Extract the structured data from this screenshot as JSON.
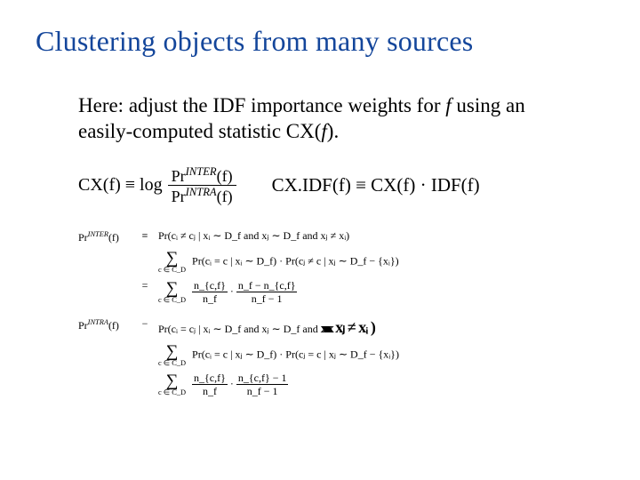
{
  "title": "Clustering objects from many sources",
  "intro": {
    "part1": "Here: adjust the IDF importance weights for ",
    "f": "f",
    "part2": " using an easily-computed statistic CX(",
    "part3": ")."
  },
  "eq": {
    "cxdef_lhs": "CX(f) ≡ log",
    "cxdef_num": "Pr",
    "cxdef_num_sup": "INTER",
    "cxdef_num_arg": "(f)",
    "cxdef_den": "Pr",
    "cxdef_den_sup": "INTRA",
    "cxdef_den_arg": "(f)",
    "cxidf": "CX.IDF(f) ≡ CX(f) · IDF(f)"
  },
  "derive": {
    "inter_lhs": "Pr",
    "inter_sup": "INTER",
    "inter_arg": "(f)",
    "eqsym": "≡",
    "inter_r1": "Pr(cᵢ ≠ cⱼ | xᵢ ∼ D_f  and  xⱼ ∼ D_f  and  xⱼ ≠ xᵢ)",
    "sum_sub": "c ∈ C_D",
    "inter_r2a": "Pr(cᵢ = c | xᵢ ∼ D_f) · Pr(cⱼ ≠ c | xⱼ ∼ D_f − {xᵢ})",
    "eq": "=",
    "inter_r3_f1n": "n_{c,f}",
    "inter_r3_f1d": "n_f",
    "inter_r3_dot": "·",
    "inter_r3_f2n": "n_f − n_{c,f}",
    "inter_r3_f2d": "n_f − 1",
    "intra_lhs": "Pr",
    "intra_sup": "INTRA",
    "intra_arg": "(f)",
    "minus": "−",
    "intra_r1": "Pr(cᵢ = cⱼ | xᵢ ∼ D_f  and  xⱼ ∼ D_f  and ",
    "scribble": "xxxxxx",
    "anno": " xⱼ ≠ xᵢ )",
    "intra_r2": "Pr(cᵢ = c | xⱼ ∼ D_f) · Pr(cⱼ = c | xⱼ ∼ D_f − {xᵢ})",
    "intra_r3_f1n": "n_{c,f}",
    "intra_r3_f1d": "n_f",
    "intra_r3_f2n": "n_{c,f} − 1",
    "intra_r3_f2d": "n_f − 1"
  }
}
